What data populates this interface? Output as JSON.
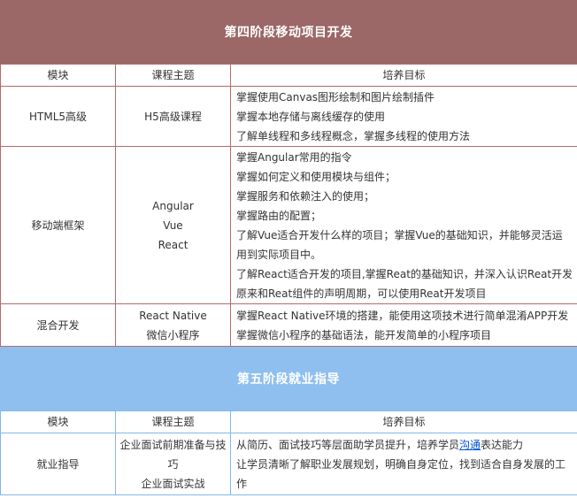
{
  "stage4": {
    "title": "第四阶段移动项目开发",
    "headers": [
      "模块",
      "课程主题",
      "培养目标"
    ],
    "rows": [
      {
        "module": "HTML5高级",
        "topics": [
          "H5高级课程"
        ],
        "goals": [
          "掌握使用Canvas图形绘制和图片绘制插件",
          "掌握本地存储与离线缓存的使用",
          "了解单线程和多线程概念，掌握多线程的使用方法"
        ]
      },
      {
        "module": "移动端框架",
        "topics": [
          "Angular",
          "Vue",
          "React"
        ],
        "goals": [
          "掌握Angular常用的指令",
          "掌握如何定义和使用模块与组件；",
          "掌握服务和依赖注入的使用；",
          "掌握路由的配置；",
          "了解Vue适合开发什么样的项目；掌握Vue的基础知识，并能够灵活运",
          "用到实际项目中。",
          "了解React适合开发的项目,掌握Reat的基础知识，并深入认识Reat开发",
          "原来和Reat组件的声明周期，可以使用Reat开发项目"
        ]
      },
      {
        "module": "混合开发",
        "topics": [
          "React Native",
          "微信小程序"
        ],
        "goals": [
          "掌握React Native环境的搭建，能使用这项技术进行简单混淆APP开发",
          "掌握微信小程序的基础语法，能开发简单的小程序项目"
        ]
      }
    ]
  },
  "stage5": {
    "title": "第五阶段就业指导",
    "headers": [
      "模块",
      "课程主题",
      "培养目标"
    ],
    "row": {
      "module": "就业指导",
      "topics": [
        "企业面试前期准备与技巧",
        "企业面试实战"
      ],
      "goal1_before": "从简历、面试技巧等层面助学员提升，培养学员",
      "goal1_link": "沟通",
      "goal1_after": "表达能力",
      "goal2": "让学员清晰了解职业发展规划，明确自身定位，找到适合自身发展的工作"
    }
  }
}
